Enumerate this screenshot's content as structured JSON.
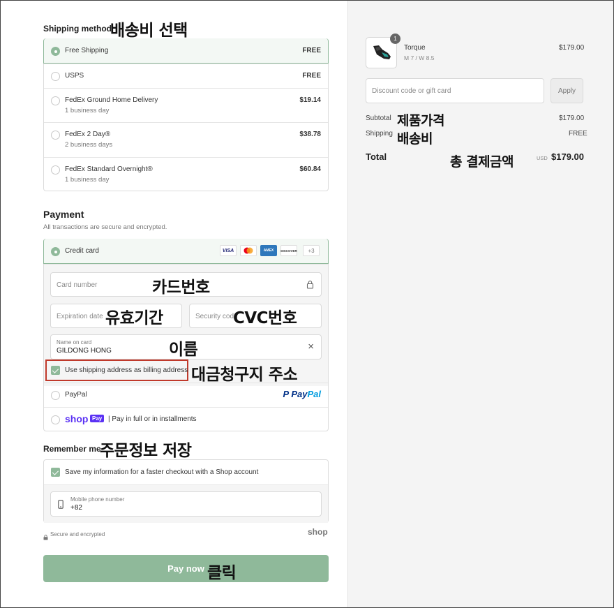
{
  "shipping": {
    "title": "Shipping method",
    "annotation": "배송비 선택",
    "options": [
      {
        "label": "Free Shipping",
        "detail": "",
        "price": "FREE",
        "selected": true
      },
      {
        "label": "USPS",
        "detail": "",
        "price": "FREE",
        "selected": false
      },
      {
        "label": "FedEx Ground Home Delivery",
        "detail": "1 business day",
        "price": "$19.14",
        "selected": false
      },
      {
        "label": "FedEx 2 Day®",
        "detail": "2 business days",
        "price": "$38.78",
        "selected": false
      },
      {
        "label": "FedEx Standard Overnight®",
        "detail": "1 business day",
        "price": "$60.84",
        "selected": false
      }
    ]
  },
  "payment": {
    "title": "Payment",
    "subtitle": "All transactions are secure and encrypted.",
    "credit_card_label": "Credit card",
    "card_logos": [
      "VISA",
      "MC",
      "AMEX",
      "DISCOVER"
    ],
    "more_cards": "+3",
    "card_number_placeholder": "Card number",
    "card_number_annotation": "카드번호",
    "expiration_placeholder": "Expiration date",
    "expiration_annotation": "유효기간",
    "security_placeholder": "Security code",
    "security_annotation": "CVC번호",
    "name_label": "Name on card",
    "name_value": "GILDONG HONG",
    "name_annotation": "이름",
    "billing_label": "Use shipping address as billing address",
    "billing_annotation": "대금청구지 주소",
    "paypal_label": "PayPal",
    "paypal_logo_p": "P",
    "paypal_logo_text_1": "Pay",
    "paypal_logo_text_2": "Pal",
    "shoppay_logo": "shop",
    "shoppay_badge": "Pay",
    "shoppay_label": "| Pay in full or in installments"
  },
  "remember": {
    "title": "Remember me",
    "annotation": "주문정보 저장",
    "save_label": "Save my information for a faster checkout with a Shop account",
    "phone_label": "Mobile phone number",
    "phone_value": "+82",
    "secure_text": "Secure and encrypted",
    "shop_logo": "shop"
  },
  "pay_button": {
    "label": "Pay now",
    "annotation": "클릭"
  },
  "summary": {
    "product_name": "Torque",
    "product_variant": "M 7 / W 8.5",
    "product_price": "$179.00",
    "quantity_badge": "1",
    "discount_placeholder": "Discount code or gift card",
    "apply_label": "Apply",
    "subtotal_label": "Subtotal",
    "subtotal_annotation": "제품가격",
    "subtotal_value": "$179.00",
    "shipping_label": "Shipping",
    "shipping_annotation": "배송비",
    "shipping_value": "FREE",
    "total_label": "Total",
    "total_annotation": "총 결제금액",
    "currency": "USD",
    "total_value": "$179.00"
  },
  "colors": {
    "accent": "#8fb99a",
    "paypal_dark": "#003087",
    "paypal_light": "#009cde",
    "shop_purple": "#5a31f4",
    "highlight_red": "#c0392b"
  }
}
